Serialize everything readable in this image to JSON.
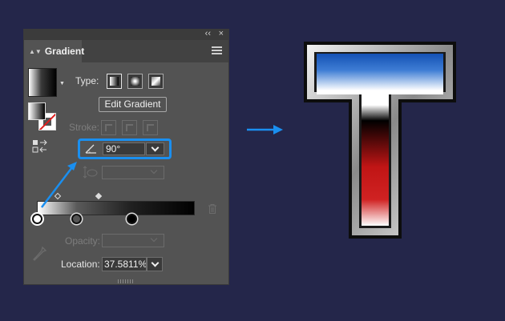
{
  "panel": {
    "tab_label": "Gradient",
    "collapse_glyph": "‹‹",
    "close_glyph": "×",
    "type_label": "Type:",
    "edit_gradient_label": "Edit Gradient",
    "stroke_label": "Stroke:",
    "angle_value": "90°",
    "opacity_label": "Opacity:",
    "location_label": "Location:",
    "location_value": "37.5811%"
  },
  "gradient_stops": [
    {
      "color": "#ffffff",
      "position": 0
    },
    {
      "color": "#555555",
      "position": 25
    },
    {
      "color": "#000000",
      "position": 60
    }
  ],
  "colors": {
    "background": "#24264a",
    "panel": "#535353",
    "highlight": "#1a8ff0",
    "arrow": "#1a8ff0"
  },
  "icons": [
    "menu-icon",
    "angle-icon",
    "aspect-ratio-icon",
    "reverse-gradient-icon",
    "trash-icon",
    "eyedropper-icon",
    "arrow-right-icon"
  ]
}
